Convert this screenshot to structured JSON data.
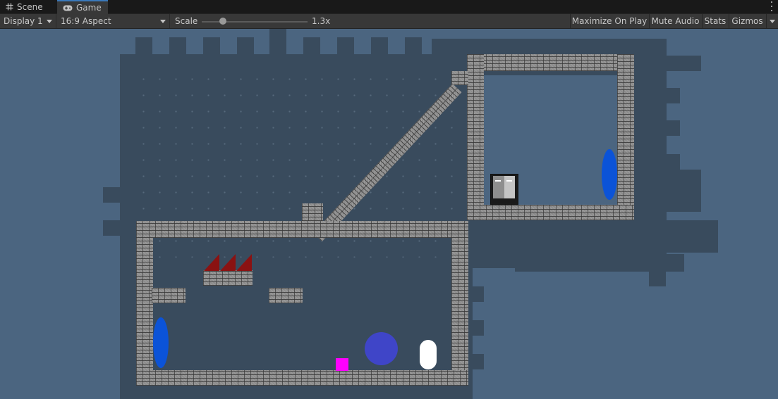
{
  "tabs": {
    "scene": {
      "label": "Scene",
      "icon": "hash-icon"
    },
    "game": {
      "label": "Game",
      "icon": "gamepad-icon",
      "active": true
    }
  },
  "toolbar": {
    "display": "Display 1",
    "aspect": "16:9 Aspect",
    "scale_label": "Scale",
    "scale_value": "1.3x",
    "scale_fraction": 0.2,
    "maximize": "Maximize On Play",
    "mute": "Mute Audio",
    "stats": "Stats",
    "gizmos": "Gizmos"
  },
  "colors": {
    "background": "#4b6580",
    "room_shadow": "#394b5d",
    "portal": "#0b53d8",
    "spike": "#8a1212",
    "ball": "#3f45c8",
    "cube": "#ff00ff",
    "capsule": "#ffffff",
    "accent": "#3a79bb"
  }
}
